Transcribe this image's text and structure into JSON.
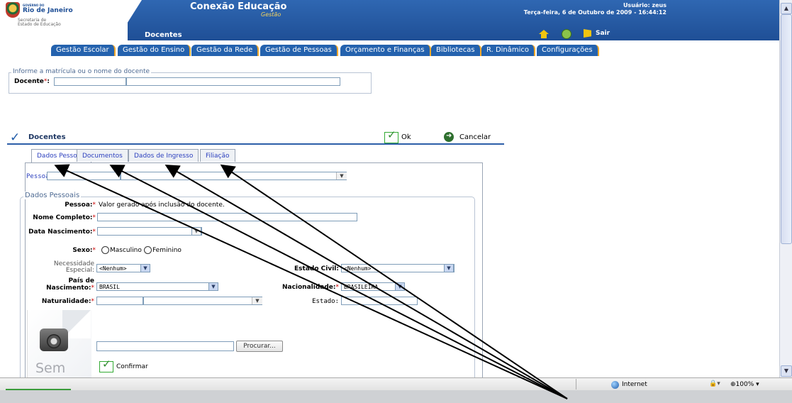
{
  "header": {
    "gov_small": "GOVERNO DO",
    "gov_big": "Rio de Janeiro",
    "secretaria_1": "Secretaria de",
    "secretaria_2": "Estado de Educação",
    "app_title": "Conexão Educação",
    "app_subtitle": "Gestão",
    "section_title": "Docentes",
    "user": "Usuário: zeus",
    "datetime": "Terça-feira, 6 de Outubro de 2009 - 16:44:12",
    "exit_label": "Sair"
  },
  "nav": {
    "items": [
      "Gestão Escolar",
      "Gestão do Ensino",
      "Gestão da Rede",
      "Gestão de Pessoas",
      "Orçamento e Finanças",
      "Bibliotecas",
      "R. Dinâmico",
      "Configurações"
    ]
  },
  "search": {
    "legend": "Informe a matrícula ou o nome do docente",
    "label": "Docente",
    "required_mark": "*",
    "colon": ":"
  },
  "toolbar": {
    "title": "Docentes",
    "ok": "Ok",
    "cancel": "Cancelar"
  },
  "tabs": [
    "Dados Pessoais",
    "Documentos",
    "Dados de Ingresso",
    "Filiação"
  ],
  "form": {
    "pessoa_label": "Pessoa",
    "section_legend": "Dados Pessoais",
    "pessoa_field_label": "Pessoa:",
    "pessoa_value": "Valor gerado após inclusão do docente.",
    "nome_label": "Nome Completo:",
    "nascimento_label": "Data Nascimento:",
    "sexo_label": "Sexo:",
    "sexo_options": [
      "Masculino",
      "Feminino"
    ],
    "necessidade_label_1": "Necessidade",
    "necessidade_label_2": "Especial:",
    "necessidade_value": "<Nenhum>",
    "estado_civil_label": "Estado Civil:",
    "estado_civil_value": "<Nenhum>",
    "pais_label_1": "País de",
    "pais_label_2": "Nascimento:",
    "pais_value": "BRASIL",
    "nacionalidade_label": "Nacionalidade:",
    "nacionalidade_value": "BRASILEIRA",
    "naturalidade_label": "Naturalidade:",
    "estado_label": "Estado:",
    "procurar": "Procurar...",
    "confirmar": "Confirmar",
    "photo_placeholder": "Sem"
  },
  "statusbar": {
    "zone": "Internet",
    "zoom": "100%"
  },
  "colors": {
    "header_blue": "#1f4f96",
    "nav_blue": "#2462ae",
    "nav_separator": "#f4a92a",
    "tab_text": "#2b3fbe",
    "required": "#cc0000"
  }
}
